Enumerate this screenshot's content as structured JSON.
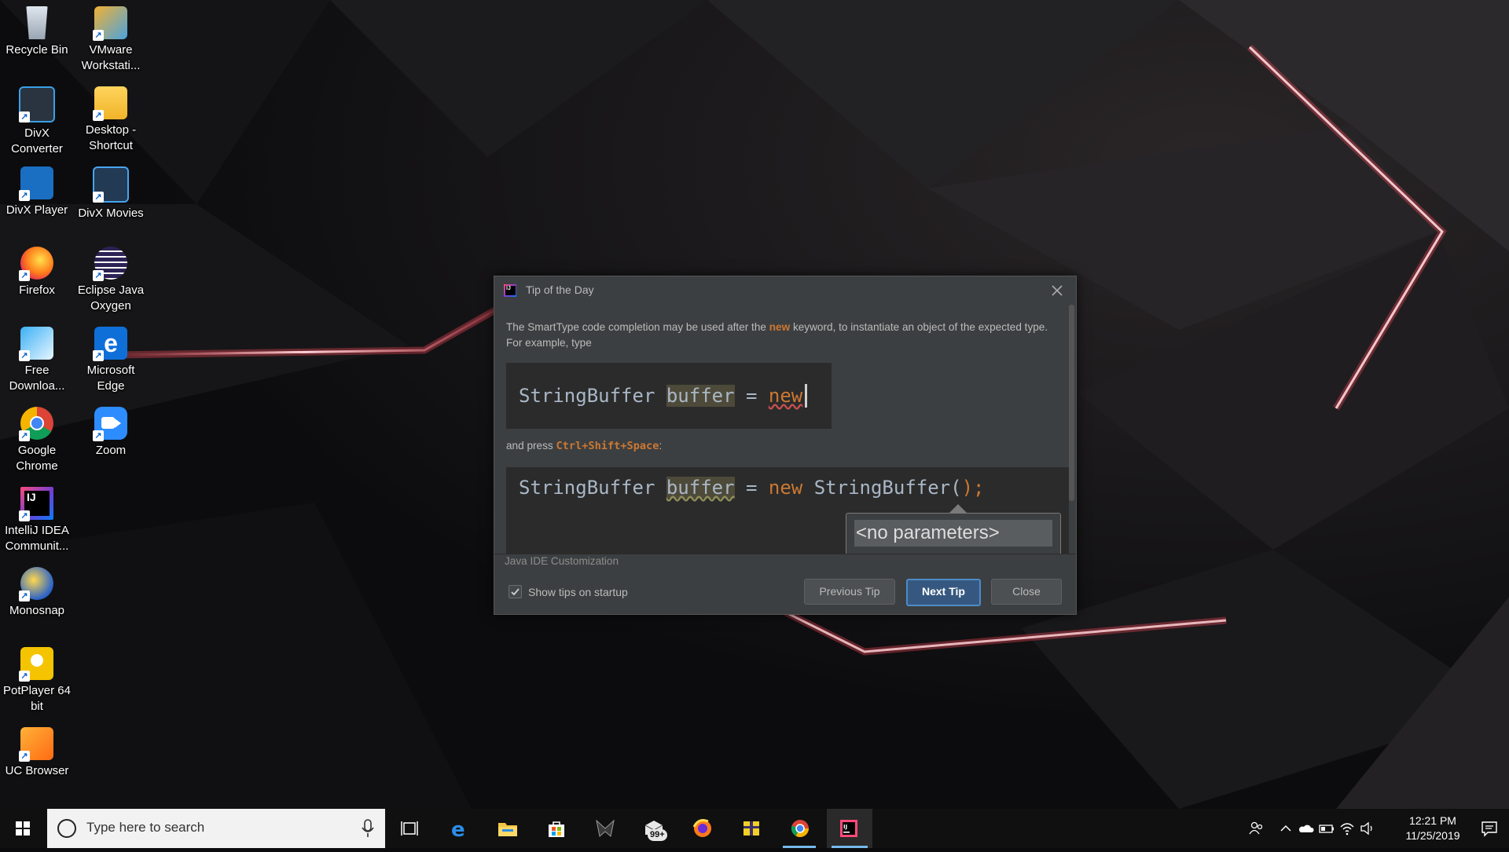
{
  "desktop": {
    "icons": [
      {
        "label": "Recycle Bin"
      },
      {
        "label": "VMware Workstati..."
      },
      {
        "label": "DivX Converter"
      },
      {
        "label": "Desktop - Shortcut"
      },
      {
        "label": "DivX Player"
      },
      {
        "label": "DivX Movies"
      },
      {
        "label": "Firefox"
      },
      {
        "label": "Eclipse Java Oxygen"
      },
      {
        "label": "Free Downloa..."
      },
      {
        "label": "Microsoft Edge"
      },
      {
        "label": "Google Chrome"
      },
      {
        "label": "Zoom"
      },
      {
        "label": "IntelliJ IDEA Communit..."
      },
      {
        "label": "Monosnap"
      },
      {
        "label": "PotPlayer 64 bit"
      },
      {
        "label": "UC Browser"
      }
    ]
  },
  "dialog": {
    "title": "Tip of the Day",
    "app_icon_text": "IJ",
    "tip_before": "The SmartType code completion may be used after the ",
    "tip_keyword": "new",
    "tip_after": " keyword, to instantiate an object of the expected type. For example, type",
    "code1": {
      "type": "StringBuffer",
      "var": "buffer",
      "op": "=",
      "kw": "new"
    },
    "press_before": "and press ",
    "press_keys": "Ctrl+Shift+Space",
    "press_after": ":",
    "code2": {
      "type": "StringBuffer",
      "var": "buffer",
      "op": "=",
      "kw": "new",
      "ctor": "StringBuffer(",
      "close": ");"
    },
    "popup_text": "<no parameters>",
    "category": "Java IDE Customization",
    "show_tips_label": "Show tips on startup",
    "show_tips_checked": true,
    "buttons": {
      "previous": "Previous Tip",
      "next": "Next Tip",
      "close": "Close"
    }
  },
  "taskbar": {
    "search_placeholder": "Type here to search",
    "mail_badge": "99+",
    "clock_time": "12:21 PM",
    "clock_date": "11/25/2019"
  },
  "colors": {
    "accent": "#4e8bc9",
    "keyword": "#cc7832",
    "dialog_bg": "#3c3f41",
    "editor_bg": "#2b2b2b"
  }
}
